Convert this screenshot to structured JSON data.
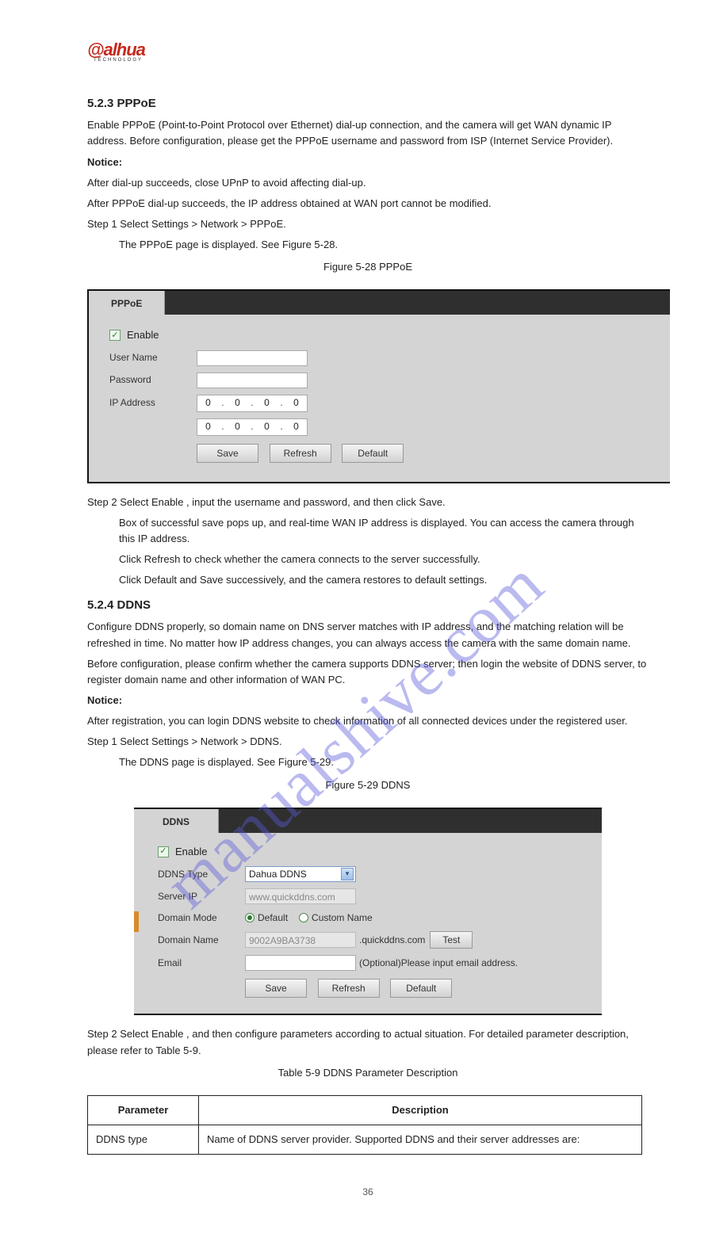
{
  "logo": {
    "text": "alhua",
    "sub": "TECHNOLOGY"
  },
  "section_pppoe": {
    "heading": "5.2.3 PPPoE",
    "p1": "Enable PPPoE (Point-to-Point Protocol over Ethernet) dial-up connection, and the camera will get WAN dynamic IP address. Before configuration, please get the PPPoE username and password from ISP (Internet Service Provider).",
    "notice_label": "Notice:",
    "p2": "After dial-up succeeds, close UPnP to avoid affecting dial-up.",
    "p3": "After PPPoE dial-up succeeds, the IP address obtained at WAN port cannot be modified.",
    "step1": "Step 1 Select Settings > Network > PPPoE.",
    "step1_after": "The PPPoE page is displayed. See Figure 5-28.",
    "fig_label": "Figure 5-28 PPPoE",
    "tab": "PPPoE",
    "enable": "Enable",
    "username_label": "User Name",
    "password_label": "Password",
    "ip_label": "IP Address",
    "ip1": [
      "0",
      "0",
      "0",
      "0"
    ],
    "ip2": [
      "0",
      "0",
      "0",
      "0"
    ],
    "save": "Save",
    "refresh": "Refresh",
    "default": "Default",
    "step2": "Step 2 Select Enable , input the username and password, and then click Save.",
    "step2_after1": "Box of successful save pops up, and real-time WAN IP address is displayed. You can access the camera through this IP address.",
    "step2_after2": "Click Refresh to check whether the camera connects to the server successfully.",
    "step2_after3": "Click Default and Save successively, and the camera restores to default settings."
  },
  "section_ddns": {
    "heading": "5.2.4 DDNS",
    "p1": "Configure DDNS properly, so domain name on DNS server matches with IP address, and the matching relation will be refreshed in time. No matter how IP address changes, you can always access the camera with the same domain name.",
    "p2": "Before configuration, please confirm whether the camera supports DDNS server; then login the website of DDNS server, to register domain name and other information of WAN PC.",
    "notice_label": "Notice:",
    "p3": "After registration, you can login DDNS website to check information of all connected devices under the registered user.",
    "step1": "Step 1 Select Settings > Network > DDNS.",
    "step1_after": "The DDNS page is displayed. See Figure 5-29.",
    "fig_label": "Figure 5-29 DDNS",
    "tab": "DDNS",
    "enable": "Enable",
    "ddns_type_label": "DDNS Type",
    "ddns_type_value": "Dahua DDNS",
    "serverip_label": "Server IP",
    "serverip_value": "www.quickddns.com",
    "domainmode_label": "Domain Mode",
    "radio_default": "Default",
    "radio_custom": "Custom Name",
    "domainname_label": "Domain Name",
    "domainname_value": "9002A9BA3738",
    "domain_suffix": ".quickddns.com",
    "test": "Test",
    "email_label": "Email",
    "email_hint": "(Optional)Please input email address.",
    "save": "Save",
    "refresh": "Refresh",
    "default": "Default",
    "step2": "Step 2 Select Enable , and then configure parameters according to actual situation. For detailed parameter description, please refer to Table 5-9.",
    "table_caption": "Table 5-9 DDNS Parameter Description",
    "th1": "Parameter",
    "th2": "Description",
    "row1_p": "DDNS type",
    "row1_d": "Name of DDNS server provider. Supported DDNS and their server addresses are:"
  },
  "watermark": "manualshive.com",
  "page_number": "36"
}
